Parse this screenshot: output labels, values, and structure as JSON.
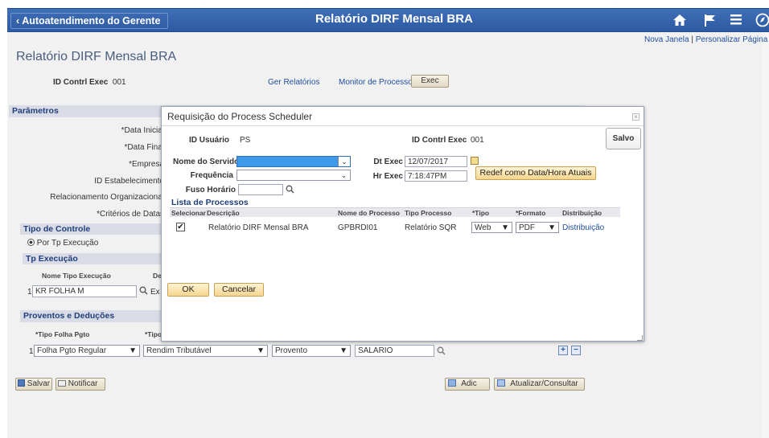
{
  "topbar": {
    "back_label": "Autoatendimento do Gerente",
    "title": "Relatório DIRF Mensal BRA",
    "icons": [
      "home-icon",
      "flag-icon",
      "menu-icon",
      "navbar-icon"
    ]
  },
  "header_links": {
    "new_window": "Nova Janela",
    "separator": "|",
    "personalize": "Personalizar Página"
  },
  "page": {
    "title": "Relatório DIRF Mensal BRA",
    "run_control_label": "ID Contrl Exec",
    "run_control_value": "001",
    "report_manager": "Ger Relatórios",
    "process_monitor": "Monitor de Processos",
    "exec_button": "Exec"
  },
  "parametros": {
    "title": "Parâmetros",
    "labels": [
      "*Data Inicial",
      "*Data Final",
      "*Empresa",
      "ID Estabelecimento",
      "Relacionamento Organizacional",
      "*Critérios de Datas"
    ]
  },
  "tipo_controle": {
    "title": "Tipo de Controle",
    "radio_label": "Por Tp Execução",
    "grid_title": "Tp Execução",
    "col1": "Nome Tipo Execução",
    "col2": "De",
    "row_num": "1",
    "row_value": "KR FOLHA M",
    "row_extra": "Ex"
  },
  "proventos": {
    "title": "Proventos e Deduções",
    "col1": "*Tipo Folha Pgto",
    "col2": "*Tipo",
    "row_num": "1",
    "tipo_folha": "Folha Pgto Regular",
    "tipo": "Rendim Tributável",
    "tipo2": "Provento",
    "codigo": "SALARIO",
    "add": "+",
    "remove": "−"
  },
  "footer": {
    "save": "Salvar",
    "notify": "Notificar",
    "add": "Adic",
    "update": "Atualizar/Consultar"
  },
  "modal": {
    "title": "Requisição do Process Scheduler",
    "close": "×",
    "user_label": "ID Usuário",
    "user_value": "PS",
    "run_control_label": "ID Contrl Exec",
    "run_control_value": "001",
    "save_button": "Salvo",
    "server_label": "Nome do Servidor",
    "server_value": "",
    "recurrence_label": "Frequência",
    "recurrence_value": "",
    "timezone_label": "Fuso Horário",
    "timezone_value": "",
    "run_date_label": "Dt Exec",
    "run_date_value": "12/07/2017",
    "run_time_label": "Hr Exec",
    "run_time_value": "7:18:47PM",
    "reset_button": "Redef como Data/Hora Atuais",
    "process_list_title": "Lista de Processos",
    "columns": [
      "Selecionar",
      "Descrição",
      "Nome do Processo",
      "Tipo Processo",
      "*Tipo",
      "*Formato",
      "Distribuição"
    ],
    "row": {
      "selected": "✔",
      "description": "Relatório DIRF Mensal BRA",
      "process_name": "GPBRDI01",
      "process_type": "Relatório SQR",
      "type": "Web",
      "format": "PDF",
      "distribution": "Distribuição"
    },
    "ok": "OK",
    "cancel": "Cancelar"
  },
  "colors": {
    "topbar": "#3462ac",
    "section_head": "#d9dbe6",
    "highlight": "#3c9ae8",
    "link": "#1f4e9e"
  }
}
